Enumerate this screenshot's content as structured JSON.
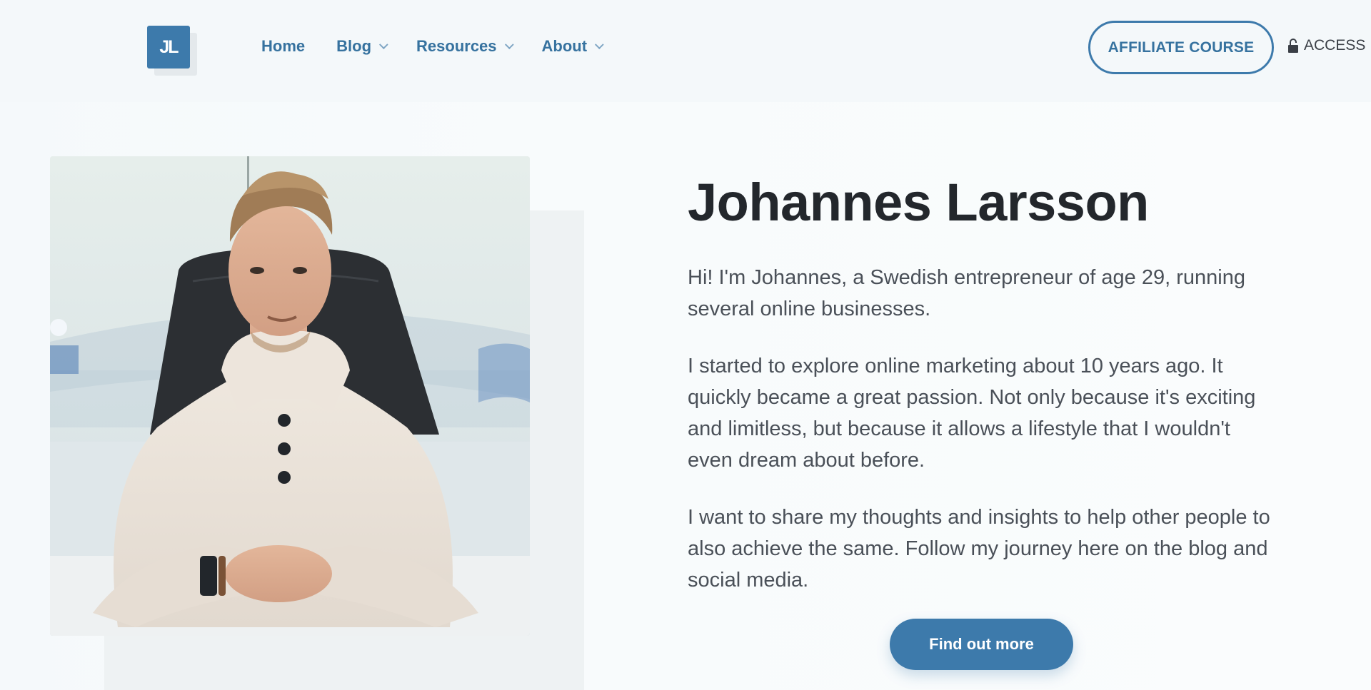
{
  "header": {
    "logo_text": "JL",
    "nav": [
      {
        "label": "Home",
        "has_dropdown": false
      },
      {
        "label": "Blog",
        "has_dropdown": true
      },
      {
        "label": "Resources",
        "has_dropdown": true
      },
      {
        "label": "About",
        "has_dropdown": true
      }
    ],
    "affiliate_button": "AFFILIATE COURSE",
    "access_label": "ACCESS",
    "access_icon": "lock-icon"
  },
  "hero": {
    "name": "Johannes Larsson",
    "paragraphs": [
      "Hi! I'm Johannes, a Swedish entrepreneur of age 29, running several online businesses.",
      "I started to explore online marketing about 10 years ago. It quickly became a great passion. Not only because it's exciting and limitless, but because it allows a lifestyle that I wouldn't even dream about before.",
      "I want to share my thoughts and insights to help other people to also achieve the same. Follow my journey here on the blog and social media."
    ],
    "cta": "Find out more"
  },
  "colors": {
    "brand": "#3d7aab",
    "nav_text": "#36729f",
    "heading": "#23272c",
    "body_text": "#4a5058"
  }
}
